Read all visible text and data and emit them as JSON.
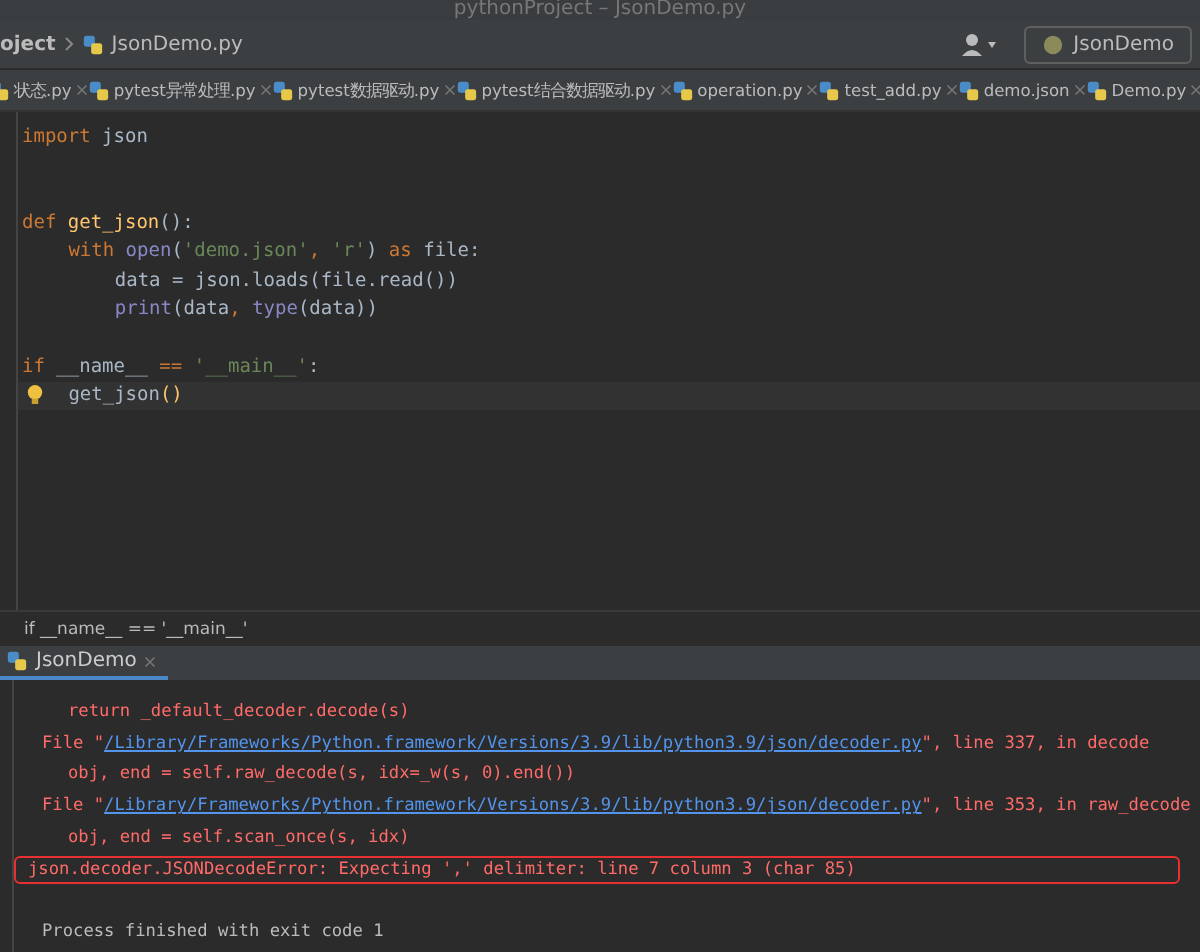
{
  "window": {
    "title": "pythonProject – JsonDemo.py"
  },
  "navbar": {
    "crumbs": [
      "oject",
      "JsonDemo.py"
    ],
    "run_config": "JsonDemo"
  },
  "tabs": [
    {
      "label": "状态.py"
    },
    {
      "label": "pytest异常处理.py"
    },
    {
      "label": "pytest数据驱动.py"
    },
    {
      "label": "pytest结合数据驱动.py"
    },
    {
      "label": "operation.py"
    },
    {
      "label": "test_add.py"
    },
    {
      "label": "demo.json"
    },
    {
      "label": "Demo.py"
    }
  ],
  "editor": {
    "lines": [
      {
        "highlighted": false,
        "tokens": [
          {
            "kind": "kw",
            "text": "import "
          },
          {
            "kind": "plain",
            "text": "json"
          }
        ]
      },
      {
        "highlighted": false
      },
      {
        "highlighted": false
      },
      {
        "highlighted": false,
        "tokens": [
          {
            "kind": "kw",
            "text": "def "
          },
          {
            "kind": "fn",
            "text": "get_json"
          },
          {
            "kind": "plain",
            "text": "():"
          }
        ],
        "children": [
          {
            "highlighted": false,
            "tokens": [
              {
                "kind": "kw",
                "text": "with "
              },
              {
                "kind": "builtin",
                "text": "open"
              },
              {
                "kind": "plain",
                "text": "("
              },
              {
                "kind": "str",
                "text": "'demo.json'"
              },
              {
                "kind": "kw",
                "text": ", "
              },
              {
                "kind": "str",
                "text": "'r'"
              },
              {
                "kind": "plain",
                "text": ") "
              },
              {
                "kind": "kw",
                "text": "as "
              },
              {
                "kind": "plain",
                "text": "file:"
              }
            ],
            "children": [
              {
                "highlighted": false,
                "tokens": [
                  {
                    "kind": "plain",
                    "text": "data = json.loads(file.read())"
                  }
                ]
              },
              {
                "highlighted": false,
                "tokens": [
                  {
                    "kind": "builtin",
                    "text": "print"
                  },
                  {
                    "kind": "plain",
                    "text": "(data"
                  },
                  {
                    "kind": "kw",
                    "text": ", "
                  },
                  {
                    "kind": "builtin",
                    "text": "type"
                  },
                  {
                    "kind": "plain",
                    "text": "(data))"
                  }
                ]
              }
            ]
          }
        ]
      },
      {
        "highlighted": false
      },
      {
        "highlighted": false,
        "tokens": [
          {
            "kind": "kw",
            "text": "if "
          },
          {
            "kind": "plain",
            "text": "__name__ "
          },
          {
            "kind": "kw",
            "text": "== "
          },
          {
            "kind": "str",
            "text": "'__main__'"
          },
          {
            "kind": "plain",
            "text": ":"
          }
        ],
        "children": [
          {
            "highlighted": true,
            "tokens": [
              {
                "kind": "plain",
                "text": "get_json"
              },
              {
                "kind": "fn",
                "text": "()"
              }
            ]
          }
        ]
      }
    ],
    "breadcrumb": "if __name__ == '__main__'"
  },
  "run_panel": {
    "tab": "JsonDemo",
    "lines": [
      {
        "kind": "code",
        "parts": [
          {
            "kind": "text",
            "text": "return _default_decoder.decode(s)"
          }
        ]
      },
      {
        "kind": "trace",
        "parts": [
          {
            "kind": "text",
            "text": "File \""
          },
          {
            "kind": "link",
            "text": "/Library/Frameworks/Python.framework/Versions/3.9/lib/python3.9/json/decoder.py"
          },
          {
            "kind": "text",
            "text": "\", line 337, in decode"
          }
        ]
      },
      {
        "kind": "code",
        "parts": [
          {
            "kind": "text",
            "text": "obj, end = self.raw_decode(s, idx=_w(s, 0).end())"
          }
        ]
      },
      {
        "kind": "trace",
        "parts": [
          {
            "kind": "text",
            "text": "File \""
          },
          {
            "kind": "link",
            "text": "/Library/Frameworks/Python.framework/Versions/3.9/lib/python3.9/json/decoder.py"
          },
          {
            "kind": "text",
            "text": "\", line 353, in raw_decode"
          }
        ]
      },
      {
        "kind": "code",
        "parts": [
          {
            "kind": "text",
            "text": "obj, end = self.scan_once(s, idx)"
          }
        ]
      },
      {
        "kind": "error",
        "parts": [
          {
            "kind": "text",
            "text": "json.decoder.JSONDecodeError: Expecting ',' delimiter: line 7 column 3 (char 85)"
          }
        ]
      },
      {
        "kind": "exit",
        "parts": [
          {
            "kind": "text",
            "text": "Process finished with exit code 1"
          }
        ]
      }
    ]
  }
}
